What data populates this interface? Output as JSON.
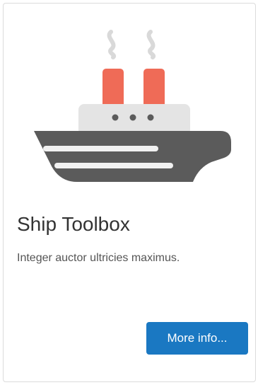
{
  "card": {
    "title": "Ship Toolbox",
    "description": "Integer auctor ultricies maximus.",
    "button_label": "More info...",
    "image_icon": "ship-icon"
  },
  "colors": {
    "button": "#1a78c2",
    "hull": "#5b5b5b",
    "cabin": "#e4e4e4",
    "chimney": "#ef6b57",
    "steam": "#d9d9d9",
    "stripe": "#f1f1f1",
    "porthole": "#5b5b5b"
  }
}
